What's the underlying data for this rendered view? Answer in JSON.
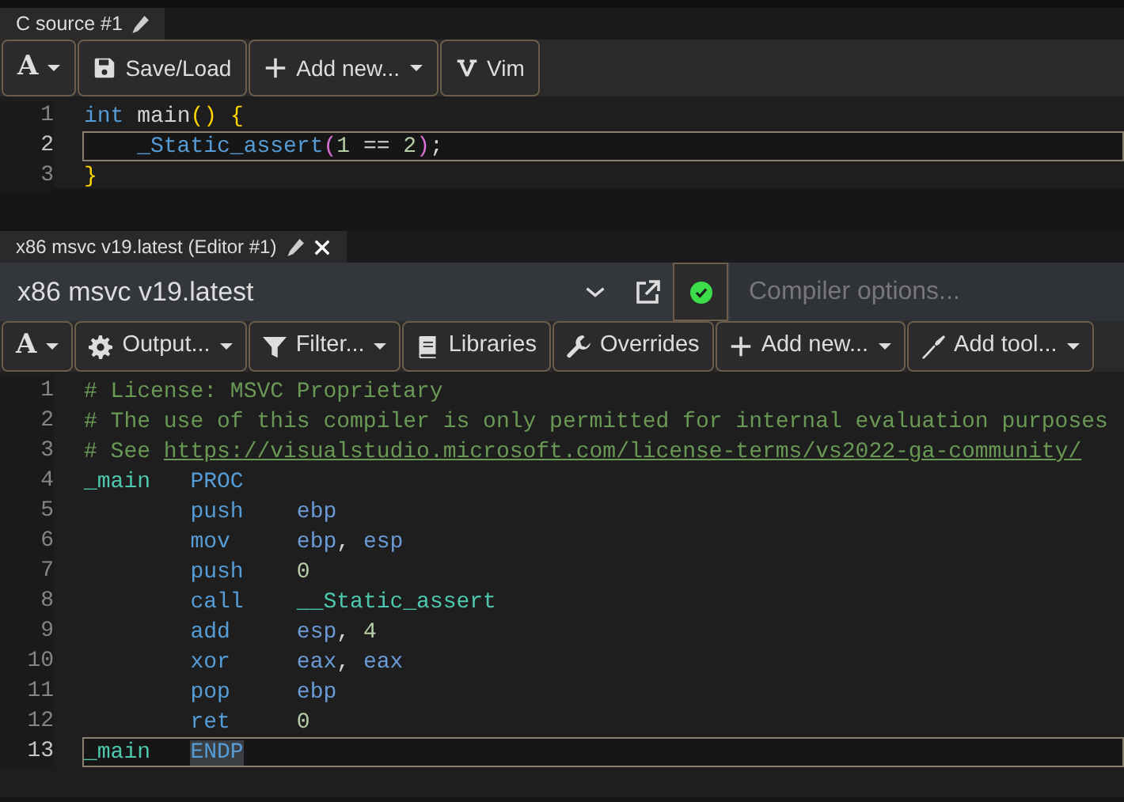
{
  "source_pane": {
    "tab": {
      "title": "C source #1",
      "selected": true
    },
    "toolbar": [
      {
        "kind": "font",
        "label": "A",
        "dropdown": true
      },
      {
        "kind": "save",
        "label": "Save/Load",
        "dropdown": false
      },
      {
        "kind": "add",
        "label": "Add new...",
        "dropdown": true
      },
      {
        "kind": "vim",
        "label": "Vim",
        "dropdown": false
      }
    ],
    "lines": [
      {
        "number": "1",
        "current": false,
        "tokens": [
          {
            "kind": "keyword",
            "text": "int"
          },
          {
            "kind": "plain",
            "text": " main"
          },
          {
            "kind": "bracket1",
            "text": "()"
          },
          {
            "kind": "bracket1",
            "text": " {"
          }
        ]
      },
      {
        "number": "2",
        "current": true,
        "tokens": [
          {
            "kind": "function",
            "text": "    _Static_assert"
          },
          {
            "kind": "bracket2",
            "text": "("
          },
          {
            "kind": "number",
            "text": "1"
          },
          {
            "kind": "plain",
            "text": " == "
          },
          {
            "kind": "number",
            "text": "2"
          },
          {
            "kind": "bracket2",
            "text": ")"
          },
          {
            "kind": "plain",
            "text": ";"
          }
        ]
      },
      {
        "number": "3",
        "current": false,
        "tokens": [
          {
            "kind": "bracket1",
            "text": "}"
          }
        ]
      }
    ]
  },
  "compiler_pane": {
    "tab": {
      "title": "x86 msvc v19.latest (Editor #1)",
      "selected": true
    },
    "compiler": "x86 msvc v19.latest",
    "status_ok": true,
    "options_placeholder": "Compiler options...",
    "toolbar": [
      {
        "kind": "font",
        "label": "A",
        "dropdown": true
      },
      {
        "kind": "output",
        "label": "Output...",
        "dropdown": true
      },
      {
        "kind": "filter",
        "label": "Filter...",
        "dropdown": true
      },
      {
        "kind": "libraries",
        "label": "Libraries",
        "dropdown": false
      },
      {
        "kind": "overrides",
        "label": "Overrides",
        "dropdown": false
      },
      {
        "kind": "add",
        "label": "Add new...",
        "dropdown": true
      },
      {
        "kind": "tool",
        "label": "Add tool...",
        "dropdown": true
      }
    ],
    "lines": [
      {
        "number": "1",
        "current": false,
        "tokens": [
          {
            "kind": "comment",
            "text": "# License: MSVC Proprietary"
          }
        ]
      },
      {
        "number": "2",
        "current": false,
        "tokens": [
          {
            "kind": "comment",
            "text": "# The use of this compiler is only permitted for internal evaluation purposes"
          }
        ]
      },
      {
        "number": "3",
        "current": false,
        "tokens": [
          {
            "kind": "comment",
            "text": "# See "
          },
          {
            "kind": "link",
            "text": "https://visualstudio.microsoft.com/license-terms/vs2022-ga-community/"
          }
        ]
      },
      {
        "number": "4",
        "current": false,
        "tokens": [
          {
            "kind": "label",
            "text": "_main"
          },
          {
            "kind": "keyword",
            "text": "   PROC"
          }
        ]
      },
      {
        "number": "5",
        "current": false,
        "tokens": [
          {
            "kind": "keyword",
            "text": "        push"
          },
          {
            "kind": "register",
            "text": "    ebp"
          }
        ]
      },
      {
        "number": "6",
        "current": false,
        "tokens": [
          {
            "kind": "keyword",
            "text": "        mov"
          },
          {
            "kind": "register",
            "text": "     ebp"
          },
          {
            "kind": "plain",
            "text": ", "
          },
          {
            "kind": "register",
            "text": "esp"
          }
        ]
      },
      {
        "number": "7",
        "current": false,
        "tokens": [
          {
            "kind": "keyword",
            "text": "        push"
          },
          {
            "kind": "number",
            "text": "    0"
          }
        ]
      },
      {
        "number": "8",
        "current": false,
        "tokens": [
          {
            "kind": "keyword",
            "text": "        call"
          },
          {
            "kind": "label",
            "text": "    __Static_assert"
          }
        ]
      },
      {
        "number": "9",
        "current": false,
        "tokens": [
          {
            "kind": "keyword",
            "text": "        add"
          },
          {
            "kind": "register",
            "text": "     esp"
          },
          {
            "kind": "plain",
            "text": ", "
          },
          {
            "kind": "number",
            "text": "4"
          }
        ]
      },
      {
        "number": "10",
        "current": false,
        "tokens": [
          {
            "kind": "keyword",
            "text": "        xor"
          },
          {
            "kind": "register",
            "text": "     eax"
          },
          {
            "kind": "plain",
            "text": ", "
          },
          {
            "kind": "register",
            "text": "eax"
          }
        ]
      },
      {
        "number": "11",
        "current": false,
        "tokens": [
          {
            "kind": "keyword",
            "text": "        pop"
          },
          {
            "kind": "register",
            "text": "     ebp"
          }
        ]
      },
      {
        "number": "12",
        "current": false,
        "tokens": [
          {
            "kind": "keyword",
            "text": "        ret"
          },
          {
            "kind": "number",
            "text": "     0"
          }
        ]
      },
      {
        "number": "13",
        "current": true,
        "tokens": [
          {
            "kind": "label",
            "text": "_main   "
          },
          {
            "kind": "selected",
            "text": "ENDP"
          }
        ]
      }
    ]
  }
}
